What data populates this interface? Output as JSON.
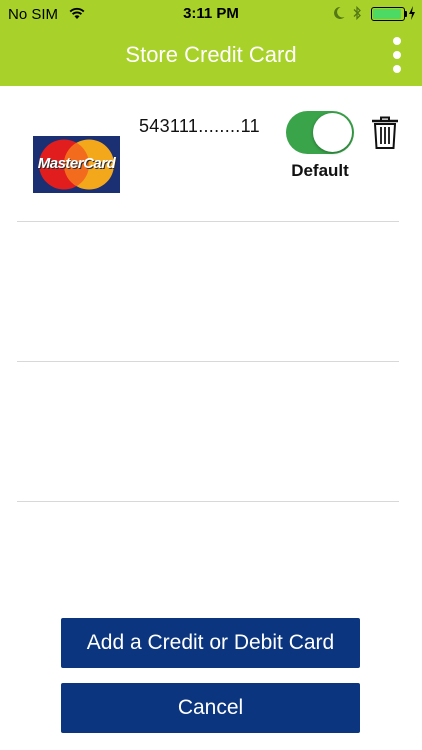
{
  "status_bar": {
    "carrier": "No SIM",
    "time": "3:11 PM",
    "battery_color": "#4cd964",
    "battery_level_percent": 92
  },
  "header": {
    "title": "Store Credit Card",
    "background_color": "#a8d129",
    "menu_icon": "kebab-menu-icon"
  },
  "cards": [
    {
      "brand_logo_text": "MasterCard",
      "number": "543111........11",
      "is_default": true,
      "default_label": "Default",
      "toggle_color": "#3aa44a",
      "delete_icon": "trash-icon"
    }
  ],
  "buttons": {
    "add_label": "Add a Credit or Debit Card",
    "cancel_label": "Cancel",
    "color": "#0b357e"
  }
}
